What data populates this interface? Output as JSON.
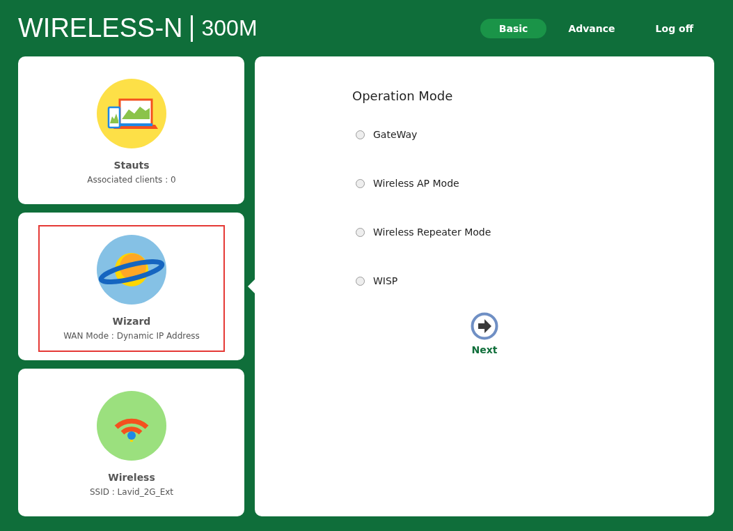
{
  "header": {
    "brand": "WIRELESS-N",
    "model": "300M"
  },
  "nav": [
    {
      "label": "Basic",
      "selected": true
    },
    {
      "label": "Advance",
      "selected": false
    },
    {
      "label": "Log off",
      "selected": false
    }
  ],
  "cards": [
    {
      "kind": "status",
      "title": "Stauts",
      "subtitle": "Associated clients : 0",
      "selected": false,
      "highlighted": false
    },
    {
      "kind": "wizard",
      "title": "Wizard",
      "subtitle": "WAN Mode : Dynamic IP Address",
      "selected": true,
      "highlighted": true
    },
    {
      "kind": "wireless",
      "title": "Wireless",
      "subtitle": "SSID : Lavid_2G_Ext",
      "selected": false,
      "highlighted": false
    }
  ],
  "panel": {
    "title": "Operation Mode",
    "options": [
      {
        "label": "GateWay",
        "checked": false
      },
      {
        "label": "Wireless AP Mode",
        "checked": false
      },
      {
        "label": "Wireless Repeater Mode",
        "checked": false
      },
      {
        "label": "WISP",
        "checked": false
      }
    ],
    "next_label": "Next"
  }
}
